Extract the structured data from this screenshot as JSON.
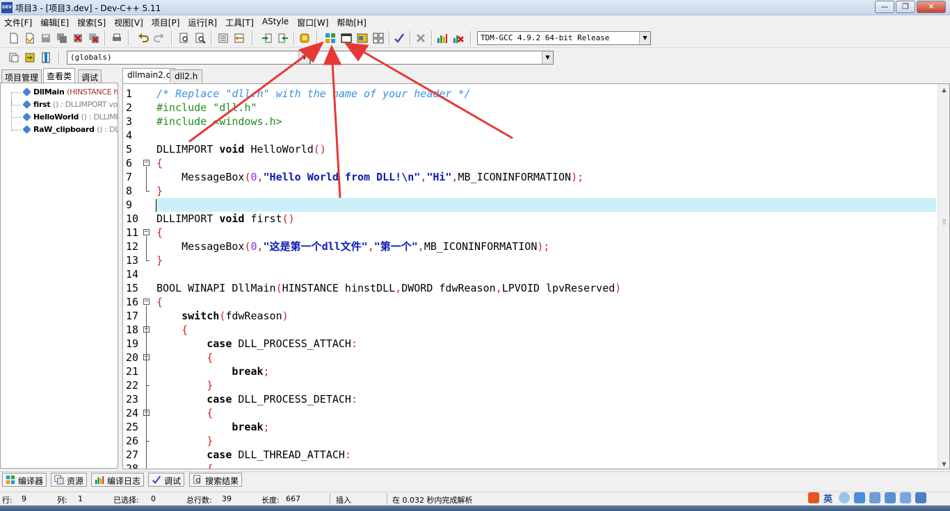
{
  "window": {
    "title": "项目3 - [项目3.dev] - Dev-C++ 5.11",
    "app_icon_text": "DEV",
    "minimize": "—",
    "maximize": "❐",
    "close": "✕"
  },
  "menu": [
    "文件[F]",
    "编辑[E]",
    "搜索[S]",
    "视图[V]",
    "项目[P]",
    "运行[R]",
    "工具[T]",
    "AStyle",
    "窗口[W]",
    "帮助[H]"
  ],
  "toolbar": {
    "compiler_select": "TDM-GCC 4.9.2 64-bit Release",
    "globals_select": "(globals)",
    "member_select": ""
  },
  "left_panel": {
    "tabs": [
      "项目管理",
      "查看类",
      "调试"
    ],
    "active_tab": 1,
    "items": [
      {
        "name": "DllMain",
        "sig": "(HINSTANCE hinstDLL, DWORD fdwReason, LPVOID lpvReserved)",
        "sig_style": "red"
      },
      {
        "name": "first",
        "sig": "() : DLLIMPORT void",
        "sig_style": "grey"
      },
      {
        "name": "HelloWorld",
        "sig": "() : DLLIMPORT void",
        "sig_style": "grey"
      },
      {
        "name": "RaW_clipboard",
        "sig": "() : DLLIMPORT void",
        "sig_style": "grey"
      }
    ]
  },
  "editor": {
    "tabs": [
      "dllmain2.c",
      "dll2.h"
    ],
    "active_tab": 0,
    "current_line": 9,
    "lines": [
      {
        "n": "1",
        "t": "/* Replace \"dll.h\" with the name of your header */"
      },
      {
        "n": "2",
        "t": "#include \"dll.h\""
      },
      {
        "n": "3",
        "t": "#include <windows.h>"
      },
      {
        "n": "4",
        "t": ""
      },
      {
        "n": "5",
        "t": "DLLIMPORT void HelloWorld()"
      },
      {
        "n": "6",
        "t": "{"
      },
      {
        "n": "7",
        "t": "    MessageBox(0,\"Hello World from DLL!\\n\",\"Hi\",MB_ICONINFORMATION);"
      },
      {
        "n": "8",
        "t": "}"
      },
      {
        "n": "9",
        "t": ""
      },
      {
        "n": "10",
        "t": "DLLIMPORT void first()"
      },
      {
        "n": "11",
        "t": "{"
      },
      {
        "n": "12",
        "t": "    MessageBox(0,\"这是第一个dll文件\",\"第一个\",MB_ICONINFORMATION);"
      },
      {
        "n": "13",
        "t": "}"
      },
      {
        "n": "14",
        "t": ""
      },
      {
        "n": "15",
        "t": "BOOL WINAPI DllMain(HINSTANCE hinstDLL,DWORD fdwReason,LPVOID lpvReserved)"
      },
      {
        "n": "16",
        "t": "{"
      },
      {
        "n": "17",
        "t": "    switch(fdwReason)"
      },
      {
        "n": "18",
        "t": "    {"
      },
      {
        "n": "19",
        "t": "        case DLL_PROCESS_ATTACH:"
      },
      {
        "n": "20",
        "t": "        {"
      },
      {
        "n": "21",
        "t": "            break;"
      },
      {
        "n": "22",
        "t": "        }"
      },
      {
        "n": "23",
        "t": "        case DLL_PROCESS_DETACH:"
      },
      {
        "n": "24",
        "t": "        {"
      },
      {
        "n": "25",
        "t": "            break;"
      },
      {
        "n": "26",
        "t": "        }"
      },
      {
        "n": "27",
        "t": "        case DLL_THREAD_ATTACH:"
      },
      {
        "n": "28",
        "t": "        {"
      }
    ]
  },
  "bottom_tabs": [
    "编译器",
    "资源",
    "编译日志",
    "调试",
    "搜索结果"
  ],
  "status": {
    "row_label": "行:",
    "row": "9",
    "col_label": "列:",
    "col": "1",
    "sel_label": "已选择:",
    "sel": "0",
    "total_label": "总行数:",
    "total": "39",
    "len_label": "长度:",
    "len": "667",
    "mode": "插入",
    "parse": "在 0.032 秒内完成解析"
  },
  "tray": {
    "ime": "英"
  },
  "colors": {
    "comment": "#3a8fe6",
    "preprocessor": "#1f8b1f",
    "string": "#0a1ab4",
    "symbol": "#d42020",
    "current_line": "#ccf0f8",
    "arrow": "#e53935"
  }
}
